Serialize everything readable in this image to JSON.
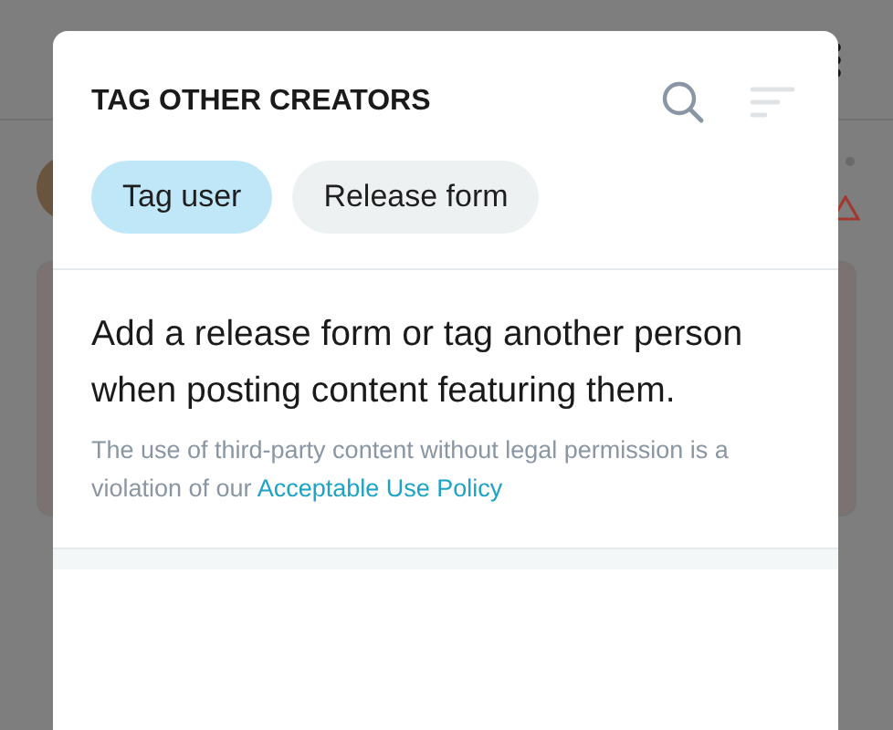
{
  "dialog": {
    "title": "TAG OTHER CREATORS",
    "tabs": [
      {
        "label": "Tag user",
        "selected": true
      },
      {
        "label": "Release form",
        "selected": false
      }
    ],
    "heading": "Add a release form or tag another person when posting content featuring them.",
    "note": "The use of third-party content without legal permission is a violation of our",
    "note_link": "Acceptable Use Policy"
  }
}
